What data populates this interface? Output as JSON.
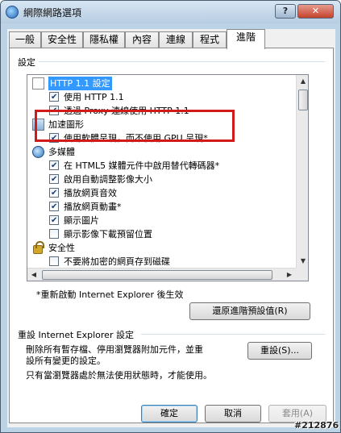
{
  "window": {
    "title": "網際網路選項",
    "help_icon": "?",
    "close_icon": "✕"
  },
  "tabs": [
    {
      "label": "一般"
    },
    {
      "label": "安全性"
    },
    {
      "label": "隱私權"
    },
    {
      "label": "內容"
    },
    {
      "label": "連線"
    },
    {
      "label": "程式"
    },
    {
      "label": "進階",
      "active": true
    }
  ],
  "settings": {
    "group_label": "設定",
    "tree": [
      {
        "type": "category",
        "icon": "page-icon",
        "label": "HTTP 1.1 設定",
        "selected": true
      },
      {
        "type": "option",
        "checked": true,
        "label": "使用 HTTP 1.1"
      },
      {
        "type": "option",
        "checked": true,
        "label": "透過 Proxy 連線使用 HTTP 1.1"
      },
      {
        "type": "category",
        "icon": "graphics-icon",
        "label": "加速圖形"
      },
      {
        "type": "option",
        "checked": true,
        "label": "使用軟體呈現，而不使用 GPU 呈現*"
      },
      {
        "type": "category",
        "icon": "multimedia-icon",
        "label": "多媒體"
      },
      {
        "type": "option",
        "checked": true,
        "label": "在 HTML5 媒體元件中啟用替代轉碼器*"
      },
      {
        "type": "option",
        "checked": true,
        "label": "啟用自動調整影像大小"
      },
      {
        "type": "option",
        "checked": true,
        "label": "播放網頁音效"
      },
      {
        "type": "option",
        "checked": true,
        "label": "播放網頁動畫*"
      },
      {
        "type": "option",
        "checked": true,
        "label": "顯示圖片"
      },
      {
        "type": "option",
        "checked": false,
        "label": "顯示影像下載預留位置"
      },
      {
        "type": "category",
        "icon": "lock-icon",
        "label": "安全性"
      },
      {
        "type": "option",
        "checked": false,
        "label": "不要將加密的網頁存到磁碟"
      }
    ],
    "restart_note": "*重新啟動 Internet Explorer 後生效",
    "restore_button": "還原進階預設值(R)"
  },
  "reset": {
    "group_label": "重設 Internet Explorer 設定",
    "description_line1": "刪除所有暫存檔、停用瀏覽器附加元件，並重",
    "description_line2": "設所有變更的設定。",
    "reset_button": "重設(S)...",
    "warning": "只有當瀏覽器處於無法使用狀態時，才能使用。"
  },
  "footer": {
    "ok": "確定",
    "cancel": "取消",
    "apply": "套用(A)"
  },
  "watermark": "#212876",
  "colors": {
    "highlight_border": "#d11b1b",
    "selection": "#3399ff"
  }
}
